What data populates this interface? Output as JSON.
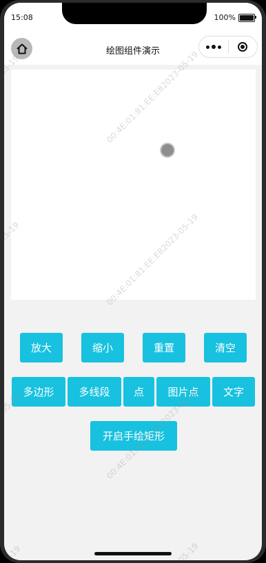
{
  "status_bar": {
    "time": "15:08",
    "battery_text": "100%",
    "battery_level": 1.0
  },
  "nav": {
    "title": "绘图组件演示",
    "home_icon": "home-icon",
    "more_icon": "more-dots-icon",
    "close_icon": "target-circle-icon"
  },
  "canvas": {
    "background": "#ffffff",
    "point_color": "#8e8e8e"
  },
  "buttons": {
    "zoom_in": "放大",
    "zoom_out": "缩小",
    "reset": "重置",
    "clear": "清空",
    "polygon": "多边形",
    "polyline": "多线段",
    "point": "点",
    "image_point": "图片点",
    "text": "文字",
    "freehand_rect": "开启手绘矩形"
  },
  "theme": {
    "accent": "#17c1df"
  },
  "watermarks": {
    "full": "00:4E:01:81:EE:E82023-05-19",
    "date": "05-19"
  }
}
